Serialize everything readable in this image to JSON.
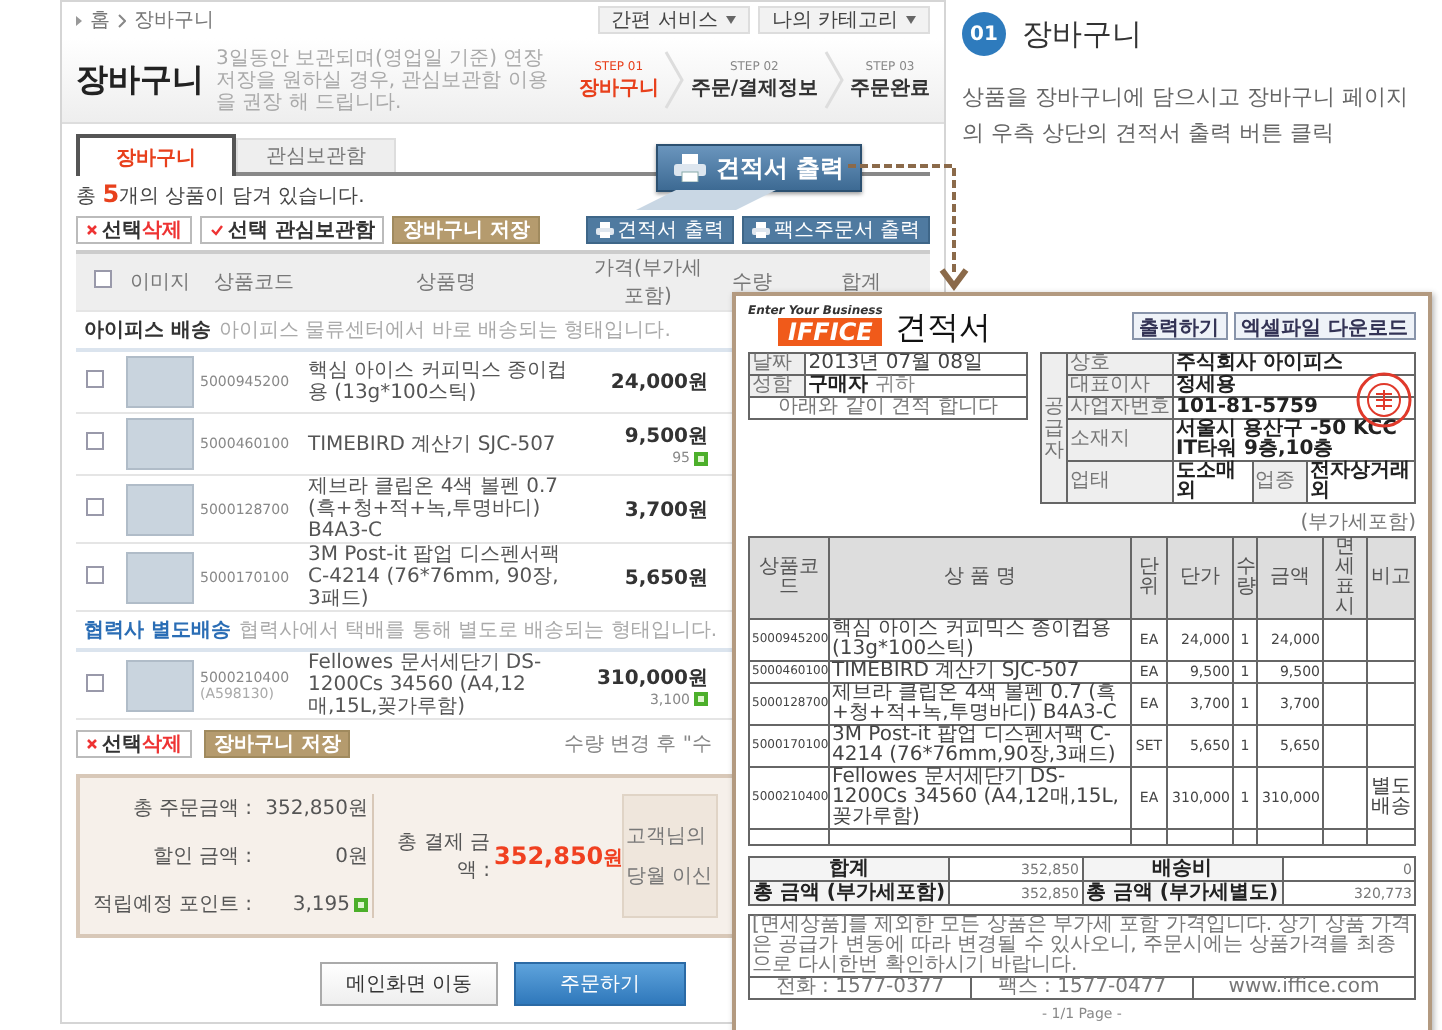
{
  "cart": {
    "breadcrumb": [
      "홈",
      "장바구니"
    ],
    "top_menus": [
      "간편 서비스",
      "나의 카테고리"
    ],
    "title": "장바구니",
    "subtitle": "3일동안 보관되며(영업일 기준) 연장 저장을 원하실 경우, 관심보관함 이용을 권장 해 드립니다.",
    "steps": [
      {
        "step": "STEP 01",
        "label": "장바구니",
        "selected": true
      },
      {
        "step": "STEP 02",
        "label": "주문/결제정보",
        "selected": false
      },
      {
        "step": "STEP 03",
        "label": "주문완료",
        "selected": false
      }
    ],
    "tabs": [
      {
        "label": "장바구니",
        "selected": true
      },
      {
        "label": "관심보관함",
        "selected": false
      }
    ],
    "summary": "총 **5**개의 상품이 담겨 있습니다.",
    "actions": [
      {
        "label": "선택**삭제**",
        "kind": "delete"
      },
      {
        "label": "선택 관심보관함",
        "kind": "save"
      },
      {
        "label": "장바구니 저장",
        "kind": "keep"
      }
    ],
    "print_buttons": [
      "견적서 출력",
      "팩스주문서 출력"
    ],
    "select_all": {
      "checked": false
    },
    "columns": [
      "이미지",
      "상품코드",
      "상품명",
      "가격(부가세 포함)",
      "수량",
      "합계"
    ],
    "groups": [
      {
        "title": "아이피스 배송",
        "color": "#333333",
        "note": "아이피스 물류센터에서 바로 배송되는 형태입니다.",
        "items": [
          {
            "code": "5000945200",
            "name": "핵심 아이스 커피믹스 종이컵용 (13g*100스틱)",
            "price": "24,000원",
            "checked": false
          },
          {
            "code": "5000460100",
            "name": "TIMEBIRD 계산기 SJC-507",
            "price": "9,500원",
            "points": "95",
            "checked": false
          },
          {
            "code": "5000128700",
            "name": "제브라 클립온 4색 볼펜 0.7 (흑+청+적+녹,투명바디) B4A3-C",
            "price": "3,700원",
            "checked": false
          },
          {
            "code": "5000170100",
            "name": "3M Post-it 팝업 디스펜서팩 C-4214 (76*76mm, 90장, 3패드)",
            "price": "5,650원",
            "checked": false
          }
        ]
      },
      {
        "title": "협력사 별도배송",
        "color": "#2a6db5",
        "note": "협력사에서 택배를 통해 별도로 배송되는 형태입니다.",
        "items": [
          {
            "code": "5000210400",
            "subcode": "(A598130)",
            "name": "Fellowes 문서세단기 DS-1200Cs 34560 (A4,12매,15L,꽂가루함)",
            "price": "310,000원",
            "points": "3,100",
            "checked": false
          }
        ]
      }
    ],
    "bottom_actions": [
      {
        "label": "선택**삭제**",
        "kind": "delete"
      },
      {
        "label": "장바구니 저장",
        "kind": "keep"
      }
    ],
    "quantity_note": "수량 변경 후 \"수",
    "totals": [
      {
        "label": "총 주문금액 :",
        "value": "352,850원"
      },
      {
        "label": "할인 금액 :",
        "value": "0원"
      },
      {
        "label": "적립예정 포인트 :",
        "value": "3,195",
        "points": true
      }
    ],
    "grand_total": {
      "label": "총 결제 금액 :",
      "value": "352,850",
      "unit": "원"
    },
    "side_notes": [
      "고객님의",
      "당월 이신"
    ],
    "buttons": [
      {
        "label": "메인화면 이동",
        "kind": "secondary"
      },
      {
        "label": "주문하기",
        "kind": "primary"
      }
    ]
  },
  "callout": {
    "label": "견적서 출력"
  },
  "guide": {
    "number": "01",
    "title": "장바구니",
    "text": "상품을 장바구니에 담으시고 장바구니 페이지의 우측 상단의 견적서 출력 버튼 클릭"
  },
  "estimate": {
    "tagline": "Enter Your Business",
    "logo": "IFFICE",
    "title": "견적서",
    "buttons": [
      "출력하기",
      "엑셀파일 다운로드"
    ],
    "customer": [
      {
        "label": "날짜",
        "value": "2013년 07월 08일"
      },
      {
        "label": "성함",
        "value": "구매자",
        "suffix": "귀하"
      }
    ],
    "greeting": "아래와 같이 견적 합니다",
    "supplier_label": "공급자",
    "supplier": [
      {
        "label": "상호",
        "value": "주식회사 아이피스"
      },
      {
        "label": "대표이사",
        "value": "정세용"
      },
      {
        "label": "사업자번호",
        "value": "101-81-5759"
      },
      {
        "label": "소재지",
        "value": "서울시 용산구 -50 KCC IT타워 9층,10층"
      }
    ],
    "business": [
      {
        "label": "업태",
        "value": "도소매 외"
      },
      {
        "label": "업종",
        "value": "전자상거래 외"
      }
    ],
    "vat_note": "(부가세포함)",
    "columns": [
      "상품코드",
      "상 품 명",
      "단위",
      "단가",
      "수량",
      "금액",
      "면세표시",
      "비고"
    ],
    "rows": [
      {
        "code": "5000945200",
        "name": "핵심 아이스 커피믹스 종이컵용 (13g*100스틱)",
        "unit": "EA",
        "price": "24,000",
        "qty": "1",
        "amount": "24,000"
      },
      {
        "code": "5000460100",
        "name": "TIMEBIRD 계산기 SJC-507",
        "unit": "EA",
        "price": "9,500",
        "qty": "1",
        "amount": "9,500"
      },
      {
        "code": "5000128700",
        "name": "제브라 클립온 4색 볼펜 0.7 (흑+청+적+녹,투명바디) B4A3-C",
        "unit": "EA",
        "price": "3,700",
        "qty": "1",
        "amount": "3,700"
      },
      {
        "code": "5000170100",
        "name": "3M Post-it 팝업 디스펜서팩 C-4214 (76*76mm,90장,3패드)",
        "unit": "SET",
        "price": "5,650",
        "qty": "1",
        "amount": "5,650"
      },
      {
        "code": "5000210400",
        "name": "Fellowes 문서세단기 DS-1200Cs 34560 (A4,12매,15L,꽂가루함)",
        "unit": "EA",
        "price": "310,000",
        "qty": "1",
        "amount": "310,000",
        "note": "별도배송"
      }
    ],
    "totals": [
      {
        "label": "합계",
        "value": "352,850"
      },
      {
        "label": "배송비",
        "value": "0"
      },
      {
        "label": "총 금액 (부가세포함)",
        "value": "352,850"
      },
      {
        "label": "총 금액 (부가세별도)",
        "value": "320,773"
      }
    ],
    "notice": "[면세상품]를 제외한 모든 상품은 부가세 포함 가격입니다. 상기 상품 가격은 공급가 변동에 따라 변경될 수 있사오니, 주문시에는 상품가격를 최종으로 다시한번 확인하시기 바랍니다.",
    "contacts": [
      "전화 : 1577-0377",
      "팩스 : 1577-0477",
      "www.iffice.com"
    ],
    "page": "- 1/1 Page -"
  }
}
